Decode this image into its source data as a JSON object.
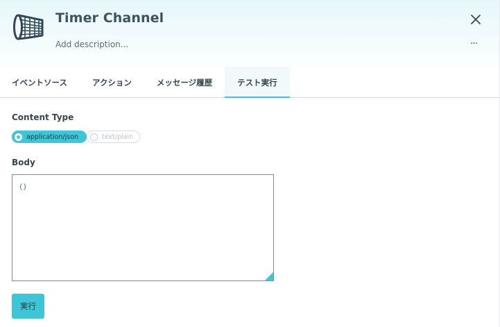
{
  "header": {
    "title": "Timer Channel",
    "description_placeholder": "Add description...",
    "more_label": "···",
    "logo_icon": "net-icon",
    "close_icon": "close-icon"
  },
  "tabs": [
    {
      "label": "イベントソース",
      "active": false
    },
    {
      "label": "アクション",
      "active": false
    },
    {
      "label": "メッセージ履歴",
      "active": false
    },
    {
      "label": "テスト実行",
      "active": true
    }
  ],
  "form": {
    "content_type_label": "Content Type",
    "content_type_options": [
      {
        "label": "application/json",
        "selected": true
      },
      {
        "label": "text/plain",
        "selected": false
      }
    ],
    "body_label": "Body",
    "body_value": "{}",
    "run_label": "実行"
  },
  "colors": {
    "accent": "#3ec6d6",
    "header_bg": "#e6f7fa",
    "text": "#37474f"
  }
}
